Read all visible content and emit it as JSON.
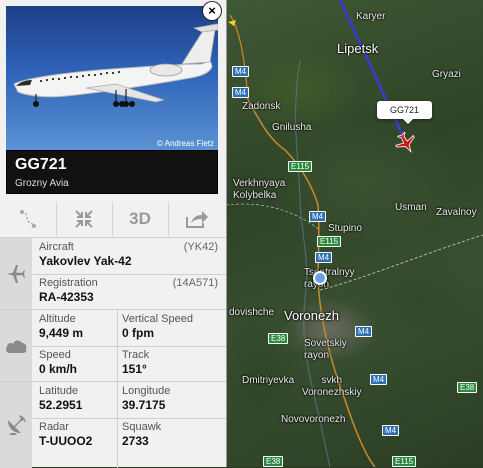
{
  "map": {
    "labels": {
      "karyer": "Karyer",
      "lipetsk": "Lipetsk",
      "gryazi": "Gryazi",
      "zadonsk": "Zadonsk",
      "gnilusha": "Gnilusha",
      "verkhnyaya": "Verkhnyaya\nKolybelka",
      "usman": "Usman",
      "zavalnoy": "Zavalnoy",
      "stupino": "Stupino",
      "tsentralnyy": "Tsentralnyy\nrayon",
      "voronezh": "Voronezh",
      "dovishche": "dovishche",
      "sovetskiy": "Sovetskiy\nrayon",
      "dmitriyevka": "Dmitriyevka",
      "voronezhskiy": "svkh\nVoronezhskiy",
      "novovoronezh": "Novovoronezh"
    },
    "roads": [
      "M4",
      "M4",
      "M4",
      "M4",
      "E115",
      "E115",
      "E115",
      "E38",
      "E38",
      "E38",
      "M4",
      "M4",
      "M4"
    ],
    "flight_tag": "GG721",
    "route_color": "#3a3ad8",
    "aircraft_color": "#d01818"
  },
  "panel": {
    "photo_credit": "© Andreas Fietz",
    "close_label": "×",
    "flight_number": "GG721",
    "airline": "Grozny Avia",
    "toolbar": {
      "route_icon": "route-icon",
      "collapse_icon": "collapse-icon",
      "three_d_label": "3D",
      "share_icon": "share-icon"
    },
    "aircraft": {
      "label": "Aircraft",
      "value": "Yakovlev Yak-42",
      "code": "(YK42)"
    },
    "registration": {
      "label": "Registration",
      "value": "RA-42353",
      "code": "(14A571)"
    },
    "altitude": {
      "label": "Altitude",
      "value": "9,449 m"
    },
    "vertical_speed": {
      "label": "Vertical Speed",
      "value": "0 fpm"
    },
    "speed": {
      "label": "Speed",
      "value": "0 km/h"
    },
    "track": {
      "label": "Track",
      "value": "151°"
    },
    "latitude": {
      "label": "Latitude",
      "value": "52.2951"
    },
    "longitude": {
      "label": "Longitude",
      "value": "39.7175"
    },
    "radar": {
      "label": "Radar",
      "value": "T-UUOO2"
    },
    "squawk": {
      "label": "Squawk",
      "value": "2733"
    }
  }
}
